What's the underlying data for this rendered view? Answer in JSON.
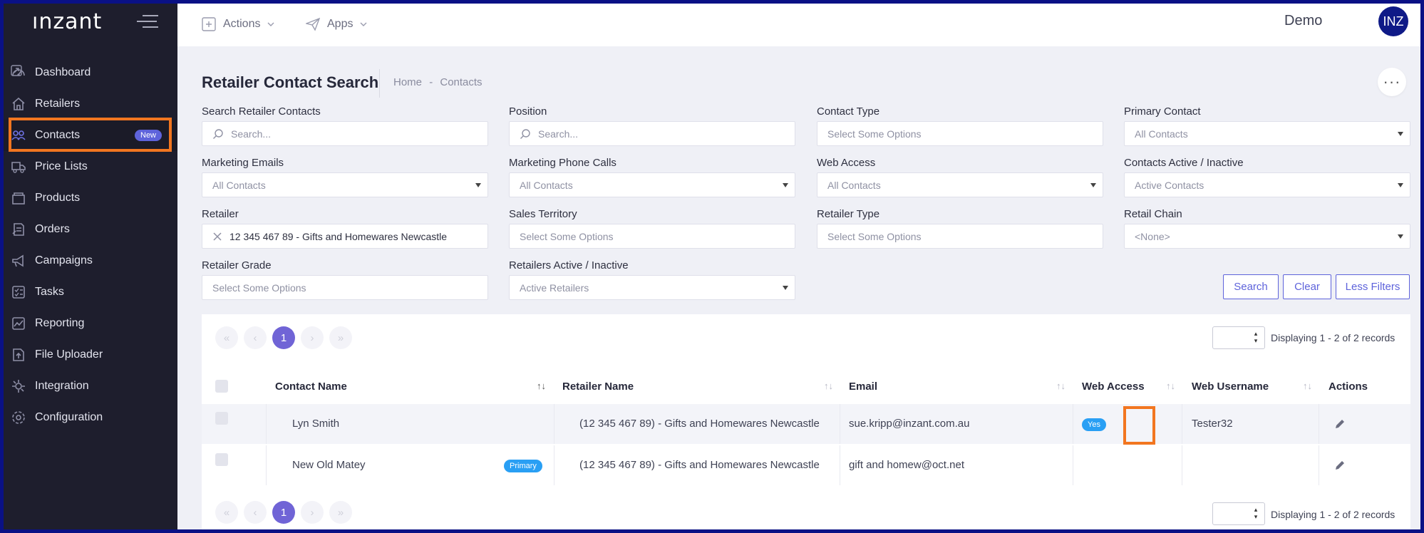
{
  "brand": {
    "logo_text": "ınzant"
  },
  "sidebar": {
    "items": [
      {
        "label": "Dashboard",
        "icon": "dashboard-icon"
      },
      {
        "label": "Retailers",
        "icon": "home-icon"
      },
      {
        "label": "Contacts",
        "icon": "users-icon",
        "badge": "New",
        "active": true
      },
      {
        "label": "Price Lists",
        "icon": "truck-icon"
      },
      {
        "label": "Products",
        "icon": "box-icon"
      },
      {
        "label": "Orders",
        "icon": "orders-icon"
      },
      {
        "label": "Campaigns",
        "icon": "megaphone-icon"
      },
      {
        "label": "Tasks",
        "icon": "tasks-icon"
      },
      {
        "label": "Reporting",
        "icon": "chart-icon"
      },
      {
        "label": "File Uploader",
        "icon": "upload-icon"
      },
      {
        "label": "Integration",
        "icon": "integration-icon"
      },
      {
        "label": "Configuration",
        "icon": "gear-icon"
      }
    ]
  },
  "topbar": {
    "actions_label": "Actions",
    "apps_label": "Apps",
    "user_name": "Demo",
    "avatar_initials": "INZ"
  },
  "page": {
    "title": "Retailer Contact Search",
    "breadcrumb_home": "Home",
    "breadcrumb_sep": "-",
    "breadcrumb_current": "Contacts",
    "more_label": "···"
  },
  "filters": {
    "search_contacts": {
      "label": "Search Retailer Contacts",
      "placeholder": "Search..."
    },
    "position": {
      "label": "Position",
      "placeholder": "Search..."
    },
    "contact_type": {
      "label": "Contact Type",
      "placeholder": "Select Some Options"
    },
    "primary_contact": {
      "label": "Primary Contact",
      "value": "All Contacts"
    },
    "marketing_emails": {
      "label": "Marketing Emails",
      "value": "All Contacts"
    },
    "marketing_calls": {
      "label": "Marketing Phone Calls",
      "value": "All Contacts"
    },
    "web_access": {
      "label": "Web Access",
      "value": "All Contacts"
    },
    "contacts_active": {
      "label": "Contacts Active / Inactive",
      "value": "Active Contacts"
    },
    "retailer": {
      "label": "Retailer",
      "value": "12 345 467 89 - Gifts and Homewares Newcastle"
    },
    "sales_territory": {
      "label": "Sales Territory",
      "placeholder": "Select Some Options"
    },
    "retailer_type": {
      "label": "Retailer Type",
      "placeholder": "Select Some Options"
    },
    "retail_chain": {
      "label": "Retail Chain",
      "value": "<None>"
    },
    "retailer_grade": {
      "label": "Retailer Grade",
      "placeholder": "Select Some Options"
    },
    "retailers_active": {
      "label": "Retailers Active / Inactive",
      "value": "Active Retailers"
    }
  },
  "buttons": {
    "search": "Search",
    "clear": "Clear",
    "less_filters": "Less Filters"
  },
  "pagination": {
    "first": "«",
    "prev": "‹",
    "current_page": "1",
    "next": "›",
    "last": "»",
    "display_text": "Displaying 1 - 2 of 2 records"
  },
  "table": {
    "headers": {
      "contact_name": "Contact Name",
      "retailer_name": "Retailer Name",
      "email": "Email",
      "web_access": "Web Access",
      "web_username": "Web Username",
      "actions": "Actions"
    },
    "rows": [
      {
        "contact_name": "Lyn Smith",
        "retailer_name": "(12 345 467 89) - Gifts and Homewares Newcastle",
        "email": "sue.kripp@inzant.com.au",
        "web_access": "Yes",
        "web_username": "Tester32",
        "badge": ""
      },
      {
        "contact_name": "New Old Matey",
        "retailer_name": "(12 345 467 89) - Gifts and Homewares Newcastle",
        "email": "gift and homew@oct.net",
        "web_access": "",
        "web_username": "",
        "badge": "Primary"
      }
    ]
  },
  "colors": {
    "sidebar_bg": "#1e1e2d",
    "accent": "#5e63db",
    "highlight": "#f27620",
    "badge_blue": "#299ff4"
  }
}
